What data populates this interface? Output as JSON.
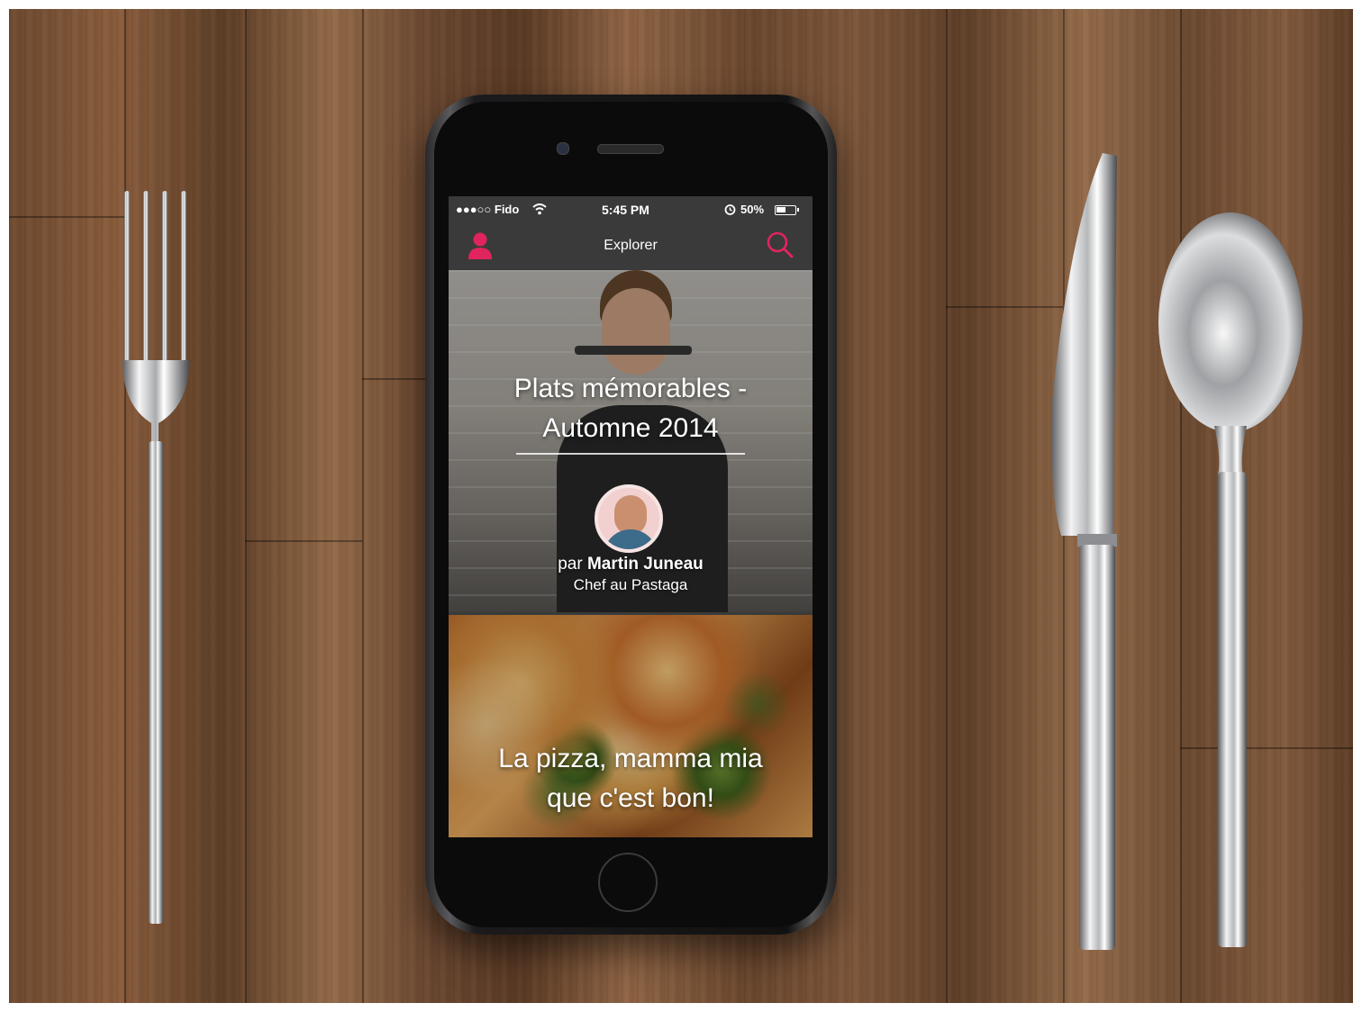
{
  "status_bar": {
    "carrier": "●●●○○ Fido",
    "time": "5:45 PM",
    "battery": "50%",
    "battery_level": 0.5
  },
  "nav": {
    "title": "Explorer"
  },
  "cards": [
    {
      "title_line1": "Plats mémorables -",
      "title_line2": "Automne 2014",
      "author_prefix": "par",
      "author_name": "Martin Juneau",
      "author_role": "Chef au Pastaga"
    },
    {
      "title_line1": "La pizza, mamma mia",
      "title_line2": "que c'est bon!"
    }
  ],
  "colors": {
    "accent": "#e0245e",
    "navbar": "#3a3a3a"
  },
  "icons": {
    "profile": "user-icon",
    "search": "search-icon"
  }
}
